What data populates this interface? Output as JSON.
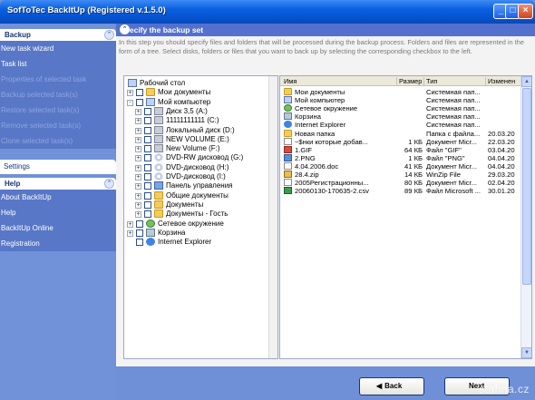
{
  "window": {
    "title": "SofToTec BackItUp (Registered v.1.5.0)"
  },
  "sidebar": {
    "backup": {
      "title": "Backup",
      "items": [
        {
          "label": "New task wizard",
          "enabled": true
        },
        {
          "label": "Task list",
          "enabled": true
        },
        {
          "label": "Properties of selected task",
          "enabled": false
        },
        {
          "label": "Backup selected task(s)",
          "enabled": false
        },
        {
          "label": "Restore selected task(s)",
          "enabled": false
        },
        {
          "label": "Remove selected task(s)",
          "enabled": false
        },
        {
          "label": "Clone selected task(s)",
          "enabled": false
        }
      ]
    },
    "settings_label": "Settings",
    "help": {
      "title": "Help",
      "items": [
        {
          "label": "About BackItUp"
        },
        {
          "label": "Help"
        },
        {
          "label": "BackItUp Online"
        },
        {
          "label": "Registration"
        }
      ]
    }
  },
  "main": {
    "header": "Specify the backup set",
    "description": "In this step you should specify files and folders that will be processed during the backup process. Folders and files are represented in the form of a tree. Select disks, folders or files that you want to back up by selecting the corresponding checkbox to the left.",
    "tree": [
      {
        "label": "Рабочий стол",
        "icon": "desktop-icon",
        "level": 0,
        "expander": "",
        "checkbox": false
      },
      {
        "label": "Мои документы",
        "icon": "folder-icon",
        "level": 1,
        "expander": "+",
        "checkbox": true
      },
      {
        "label": "Мой компьютер",
        "icon": "computer-icon",
        "level": 1,
        "expander": "-",
        "checkbox": true
      },
      {
        "label": "Диск 3,5 (A:)",
        "icon": "floppy-icon",
        "level": 2,
        "expander": "+",
        "checkbox": true
      },
      {
        "label": "11111111111 (C:)",
        "icon": "drive-icon",
        "level": 2,
        "expander": "+",
        "checkbox": true
      },
      {
        "label": "Локальный диск (D:)",
        "icon": "drive-icon",
        "level": 2,
        "expander": "+",
        "checkbox": true
      },
      {
        "label": "NEW VOLUME (E:)",
        "icon": "drive-icon",
        "level": 2,
        "expander": "+",
        "checkbox": true
      },
      {
        "label": "New Volume (F:)",
        "icon": "drive-icon",
        "level": 2,
        "expander": "+",
        "checkbox": true
      },
      {
        "label": "DVD-RW дисковод (G:)",
        "icon": "cd-icon",
        "level": 2,
        "expander": "+",
        "checkbox": true
      },
      {
        "label": "DVD-дисковод (H:)",
        "icon": "cd-icon",
        "level": 2,
        "expander": "+",
        "checkbox": true
      },
      {
        "label": "DVD-дисковод (I:)",
        "icon": "cd-icon",
        "level": 2,
        "expander": "+",
        "checkbox": true
      },
      {
        "label": "Панель управления",
        "icon": "control-panel-icon",
        "level": 2,
        "expander": "+",
        "checkbox": true
      },
      {
        "label": "Общие документы",
        "icon": "folder-icon",
        "level": 2,
        "expander": "+",
        "checkbox": true
      },
      {
        "label": "Документы",
        "icon": "folder-icon",
        "level": 2,
        "expander": "+",
        "checkbox": true
      },
      {
        "label": "Документы - Гость",
        "icon": "folder-icon",
        "level": 2,
        "expander": "+",
        "checkbox": true
      },
      {
        "label": "Сетевое окружение",
        "icon": "network-icon",
        "level": 1,
        "expander": "+",
        "checkbox": true
      },
      {
        "label": "Корзина",
        "icon": "recycle-bin-icon",
        "level": 1,
        "expander": "+",
        "checkbox": true
      },
      {
        "label": "Internet Explorer",
        "icon": "ie-icon",
        "level": 1,
        "expander": "",
        "checkbox": true
      }
    ],
    "files": {
      "columns": [
        "Имя",
        "Размер",
        "Тип",
        "Изменен"
      ],
      "rows": [
        {
          "name": "Мои документы",
          "size": "",
          "type": "Системная пап...",
          "modified": "",
          "icon": "folder-icon"
        },
        {
          "name": "Мой компьютер",
          "size": "",
          "type": "Системная пап...",
          "modified": "",
          "icon": "computer-icon"
        },
        {
          "name": "Сетевое окружение",
          "size": "",
          "type": "Системная пап...",
          "modified": "",
          "icon": "network-icon"
        },
        {
          "name": "Корзина",
          "size": "",
          "type": "Системная пап...",
          "modified": "",
          "icon": "recycle-bin-icon"
        },
        {
          "name": "Internet Explorer",
          "size": "",
          "type": "Системная пап...",
          "modified": "",
          "icon": "ie-icon"
        },
        {
          "name": "Новая папка",
          "size": "",
          "type": "Папка с файла...",
          "modified": "20.03.20",
          "icon": "folder-icon"
        },
        {
          "name": "~$нки которые добав...",
          "size": "1 КБ",
          "type": "Документ Micr...",
          "modified": "22.03.20",
          "icon": "document-icon"
        },
        {
          "name": "1.GIF",
          "size": "64 КБ",
          "type": "Файл \"GIF\"",
          "modified": "03.04.20",
          "icon": "gif-icon"
        },
        {
          "name": "2.PNG",
          "size": "1 КБ",
          "type": "Файл \"PNG\"",
          "modified": "04.04.20",
          "icon": "png-icon"
        },
        {
          "name": "4.04.2006.doc",
          "size": "41 КБ",
          "type": "Документ Micr...",
          "modified": "04.04.20",
          "icon": "document-icon"
        },
        {
          "name": "28.4.zip",
          "size": "14 КБ",
          "type": "WinZip File",
          "modified": "29.03.20",
          "icon": "zip-icon"
        },
        {
          "name": "2005Регистрационны...",
          "size": "80 КБ",
          "type": "Документ Micr...",
          "modified": "02.04.20",
          "icon": "document-icon"
        },
        {
          "name": "20060130-170635-2.csv",
          "size": "89 КБ",
          "type": "Файл Microsoft ...",
          "modified": "30.01.20",
          "icon": "spreadsheet-icon"
        }
      ]
    }
  },
  "footer": {
    "back_label": "Back",
    "next_label": "Next",
    "watermark": "stahna.cz"
  }
}
